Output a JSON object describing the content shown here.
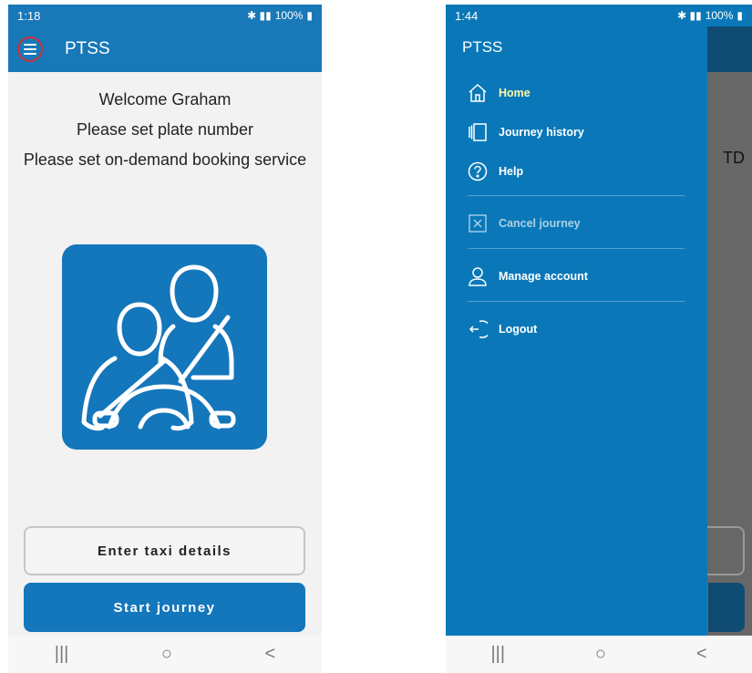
{
  "left_screen": {
    "status_bar": {
      "time": "1:18",
      "battery": "100%"
    },
    "app_bar": {
      "title": "PTSS",
      "menu_icon": "hamburger-menu-icon"
    },
    "messages": [
      "Welcome Graham",
      "Please set plate number",
      "Please set on-demand booking service"
    ],
    "illustration": "driver-passenger-seatbelt-illustration",
    "buttons": {
      "enter_taxi_details": "Enter taxi details",
      "start_journey": "Start journey"
    },
    "nav_bar": {
      "recents": "|||",
      "home": "○",
      "back": "<"
    }
  },
  "right_screen": {
    "status_bar": {
      "time": "1:44",
      "battery": "100%"
    },
    "background_text": "TD",
    "drawer": {
      "title": "PTSS",
      "items": [
        {
          "label": "Home",
          "icon": "home-icon",
          "active": true
        },
        {
          "label": "Journey history",
          "icon": "journey-history-icon"
        },
        {
          "label": "Help",
          "icon": "help-icon"
        },
        {
          "label": "Cancel journey",
          "icon": "cancel-icon",
          "disabled": true
        },
        {
          "label": "Manage account",
          "icon": "account-icon"
        },
        {
          "label": "Logout",
          "icon": "logout-icon"
        }
      ]
    },
    "nav_bar": {
      "recents": "|||",
      "home": "○",
      "back": "<"
    }
  },
  "colors": {
    "primary_blue": "#1476bb",
    "drawer_blue": "#0a78b8",
    "active_item": "#fff7a6",
    "menu_highlight": "#c8323c"
  }
}
